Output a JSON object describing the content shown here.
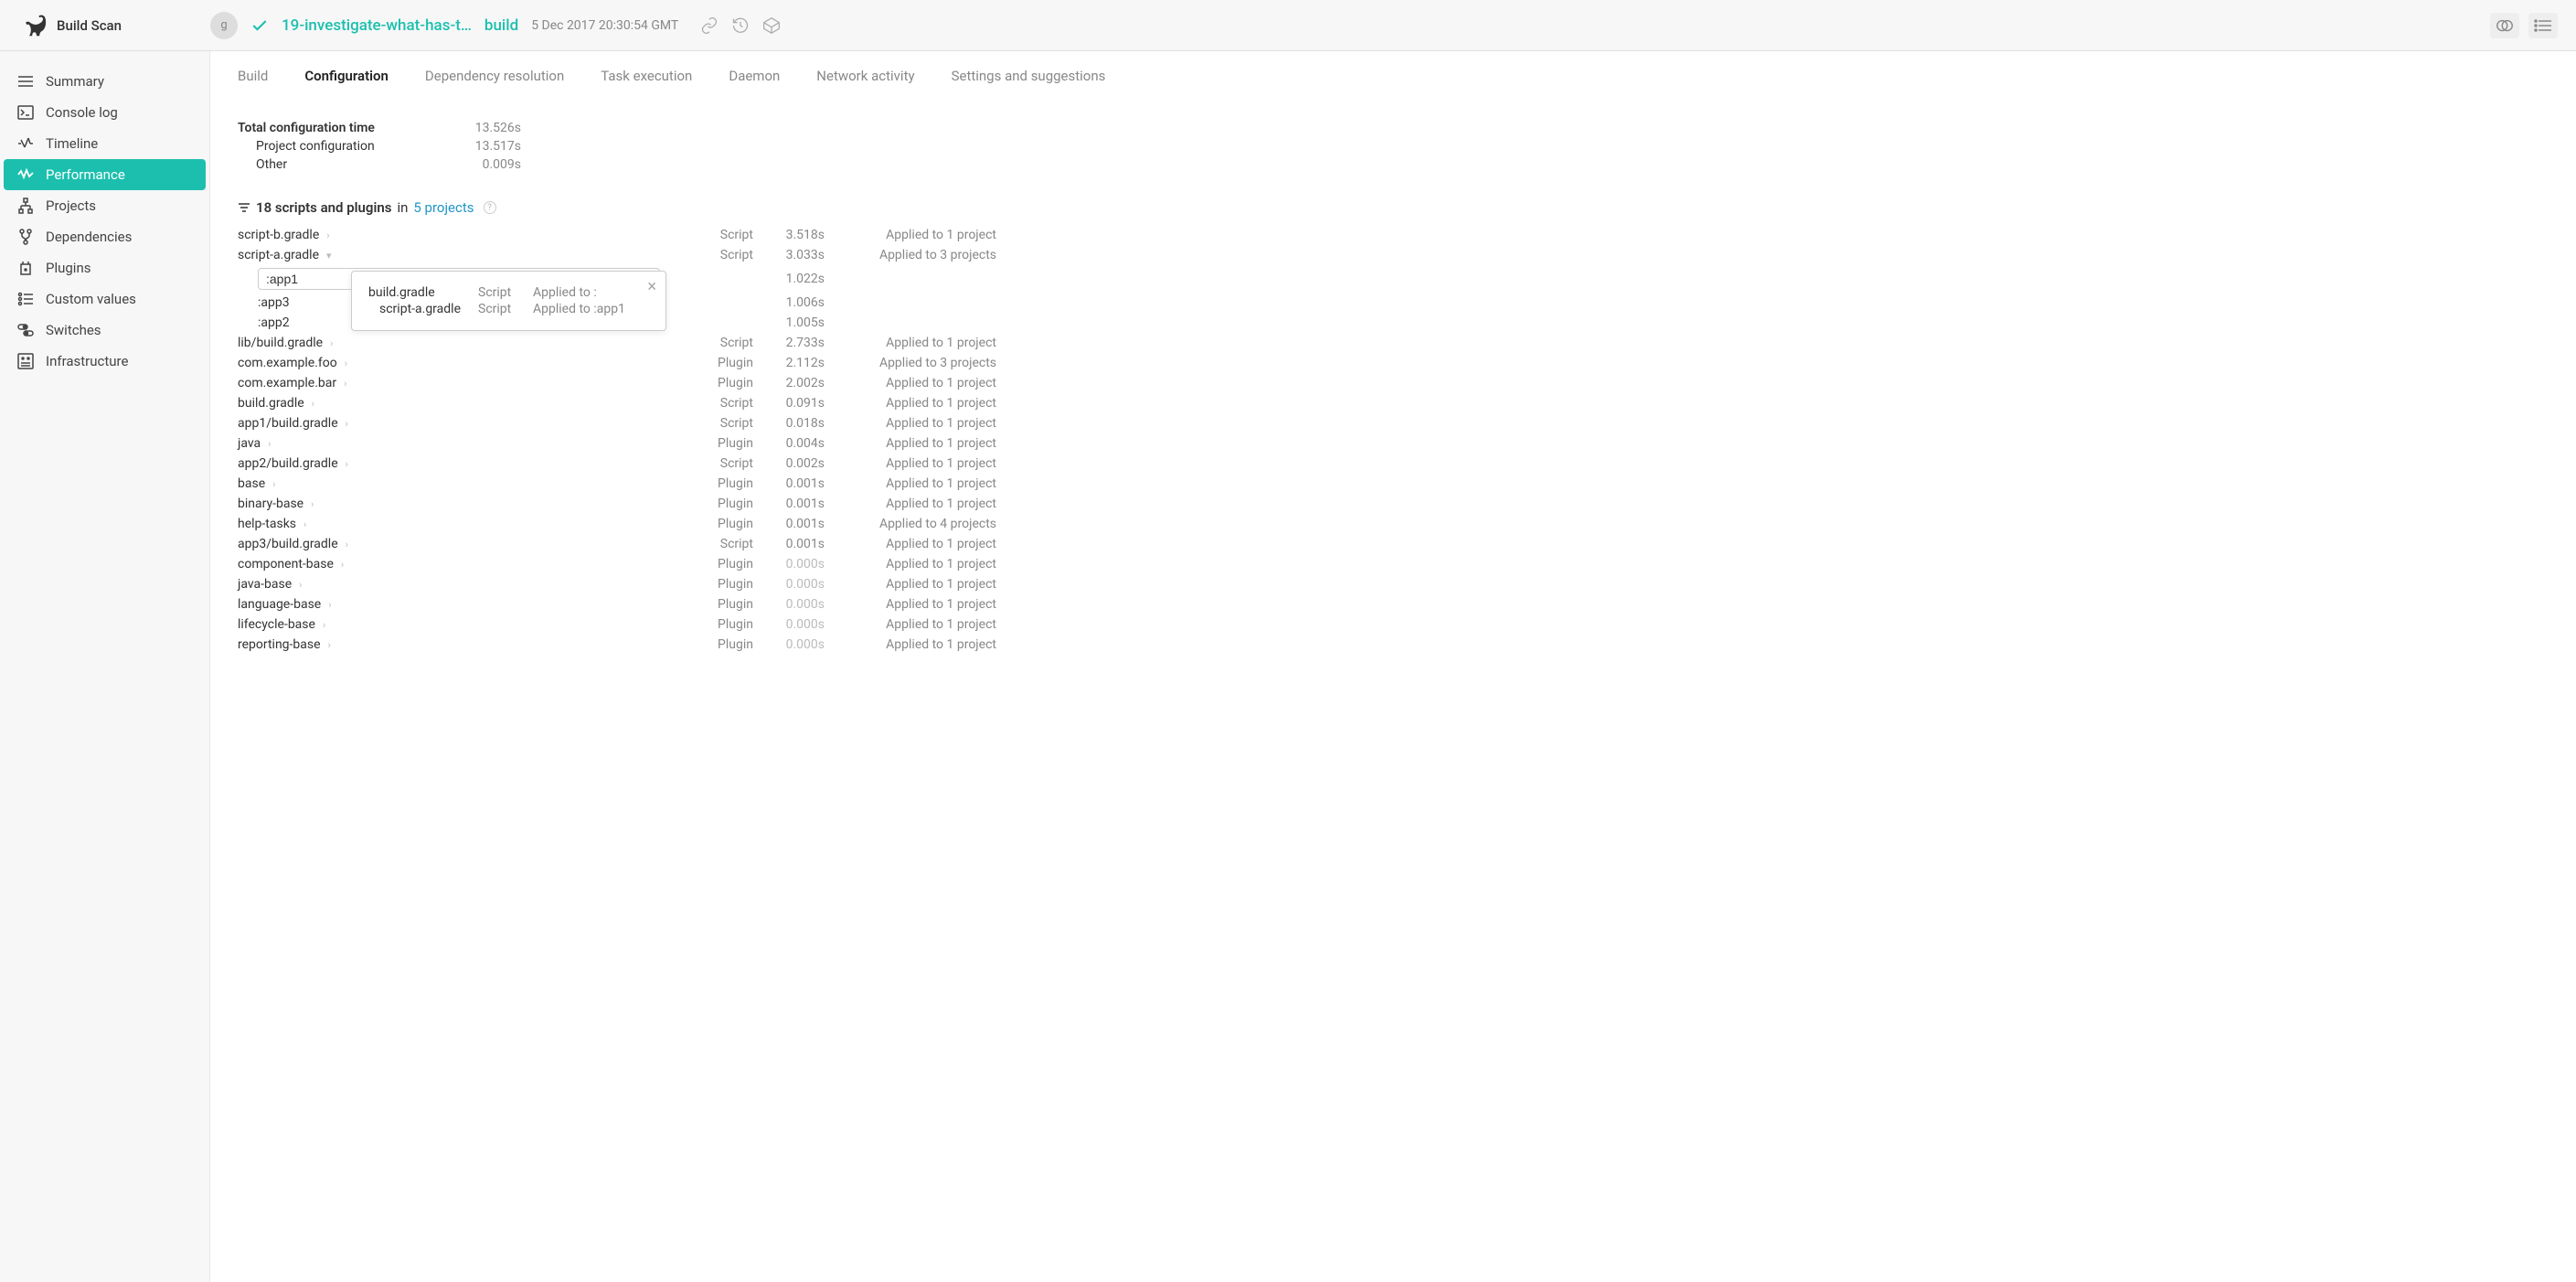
{
  "header": {
    "logo_text": "Build Scan",
    "avatar_initial": "g",
    "scan_title": "19-investigate-what-has-t…",
    "build_label": "build",
    "date": "5 Dec 2017 20:30:54 GMT"
  },
  "sidebar": {
    "items": [
      {
        "label": "Summary"
      },
      {
        "label": "Console log"
      },
      {
        "label": "Timeline"
      },
      {
        "label": "Performance"
      },
      {
        "label": "Projects"
      },
      {
        "label": "Dependencies"
      },
      {
        "label": "Plugins"
      },
      {
        "label": "Custom values"
      },
      {
        "label": "Switches"
      },
      {
        "label": "Infrastructure"
      }
    ],
    "active_index": 3
  },
  "tabs": {
    "items": [
      "Build",
      "Configuration",
      "Dependency resolution",
      "Task execution",
      "Daemon",
      "Network activity",
      "Settings and suggestions"
    ],
    "active_index": 1
  },
  "metrics": {
    "total_label": "Total configuration time",
    "total_value": "13.526s",
    "project_label": "Project configuration",
    "project_value": "13.517s",
    "other_label": "Other",
    "other_value": "0.009s"
  },
  "section": {
    "count": "18 scripts and plugins",
    "in": " in ",
    "projects_link": "5 projects"
  },
  "expanded": {
    "input_value": ":app1",
    "children": [
      {
        "name": ":app3",
        "time": "1.006s"
      },
      {
        "name": ":app2",
        "time": "1.005s"
      }
    ],
    "popover": {
      "rows": [
        {
          "name": "build.gradle",
          "type": "Script",
          "applied": "Applied to :"
        },
        {
          "name": "script-a.gradle",
          "type": "Script",
          "applied": "Applied to :app1"
        }
      ]
    }
  },
  "rows": [
    {
      "name": "script-b.gradle",
      "type": "Script",
      "time": "3.518s",
      "applied": "Applied to 1 project",
      "chevron": "right"
    },
    {
      "name": "script-a.gradle",
      "type": "Script",
      "time": "3.033s",
      "applied": "Applied to 3 projects",
      "chevron": "down",
      "expanded": true
    },
    {
      "name": "lib/build.gradle",
      "type": "Script",
      "time": "2.733s",
      "applied": "Applied to 1 project",
      "chevron": "right"
    },
    {
      "name": "com.example.foo",
      "type": "Plugin",
      "time": "2.112s",
      "applied": "Applied to 3 projects",
      "chevron": "right"
    },
    {
      "name": "com.example.bar",
      "type": "Plugin",
      "time": "2.002s",
      "applied": "Applied to 1 project",
      "chevron": "right"
    },
    {
      "name": "build.gradle",
      "type": "Script",
      "time": "0.091s",
      "applied": "Applied to 1 project",
      "chevron": "right"
    },
    {
      "name": "app1/build.gradle",
      "type": "Script",
      "time": "0.018s",
      "applied": "Applied to 1 project",
      "chevron": "right"
    },
    {
      "name": "java",
      "type": "Plugin",
      "time": "0.004s",
      "applied": "Applied to 1 project",
      "chevron": "right"
    },
    {
      "name": "app2/build.gradle",
      "type": "Script",
      "time": "0.002s",
      "applied": "Applied to 1 project",
      "chevron": "right"
    },
    {
      "name": "base",
      "type": "Plugin",
      "time": "0.001s",
      "applied": "Applied to 1 project",
      "chevron": "right"
    },
    {
      "name": "binary-base",
      "type": "Plugin",
      "time": "0.001s",
      "applied": "Applied to 1 project",
      "chevron": "right"
    },
    {
      "name": "help-tasks",
      "type": "Plugin",
      "time": "0.001s",
      "applied": "Applied to 4 projects",
      "chevron": "right"
    },
    {
      "name": "app3/build.gradle",
      "type": "Script",
      "time": "0.001s",
      "applied": "Applied to 1 project",
      "chevron": "right"
    },
    {
      "name": "component-base",
      "type": "Plugin",
      "time": "0.000s",
      "applied": "Applied to 1 project",
      "chevron": "right",
      "zero": true
    },
    {
      "name": "java-base",
      "type": "Plugin",
      "time": "0.000s",
      "applied": "Applied to 1 project",
      "chevron": "right",
      "zero": true
    },
    {
      "name": "language-base",
      "type": "Plugin",
      "time": "0.000s",
      "applied": "Applied to 1 project",
      "chevron": "right",
      "zero": true
    },
    {
      "name": "lifecycle-base",
      "type": "Plugin",
      "time": "0.000s",
      "applied": "Applied to 1 project",
      "chevron": "right",
      "zero": true
    },
    {
      "name": "reporting-base",
      "type": "Plugin",
      "time": "0.000s",
      "applied": "Applied to 1 project",
      "chevron": "right",
      "zero": true
    }
  ]
}
